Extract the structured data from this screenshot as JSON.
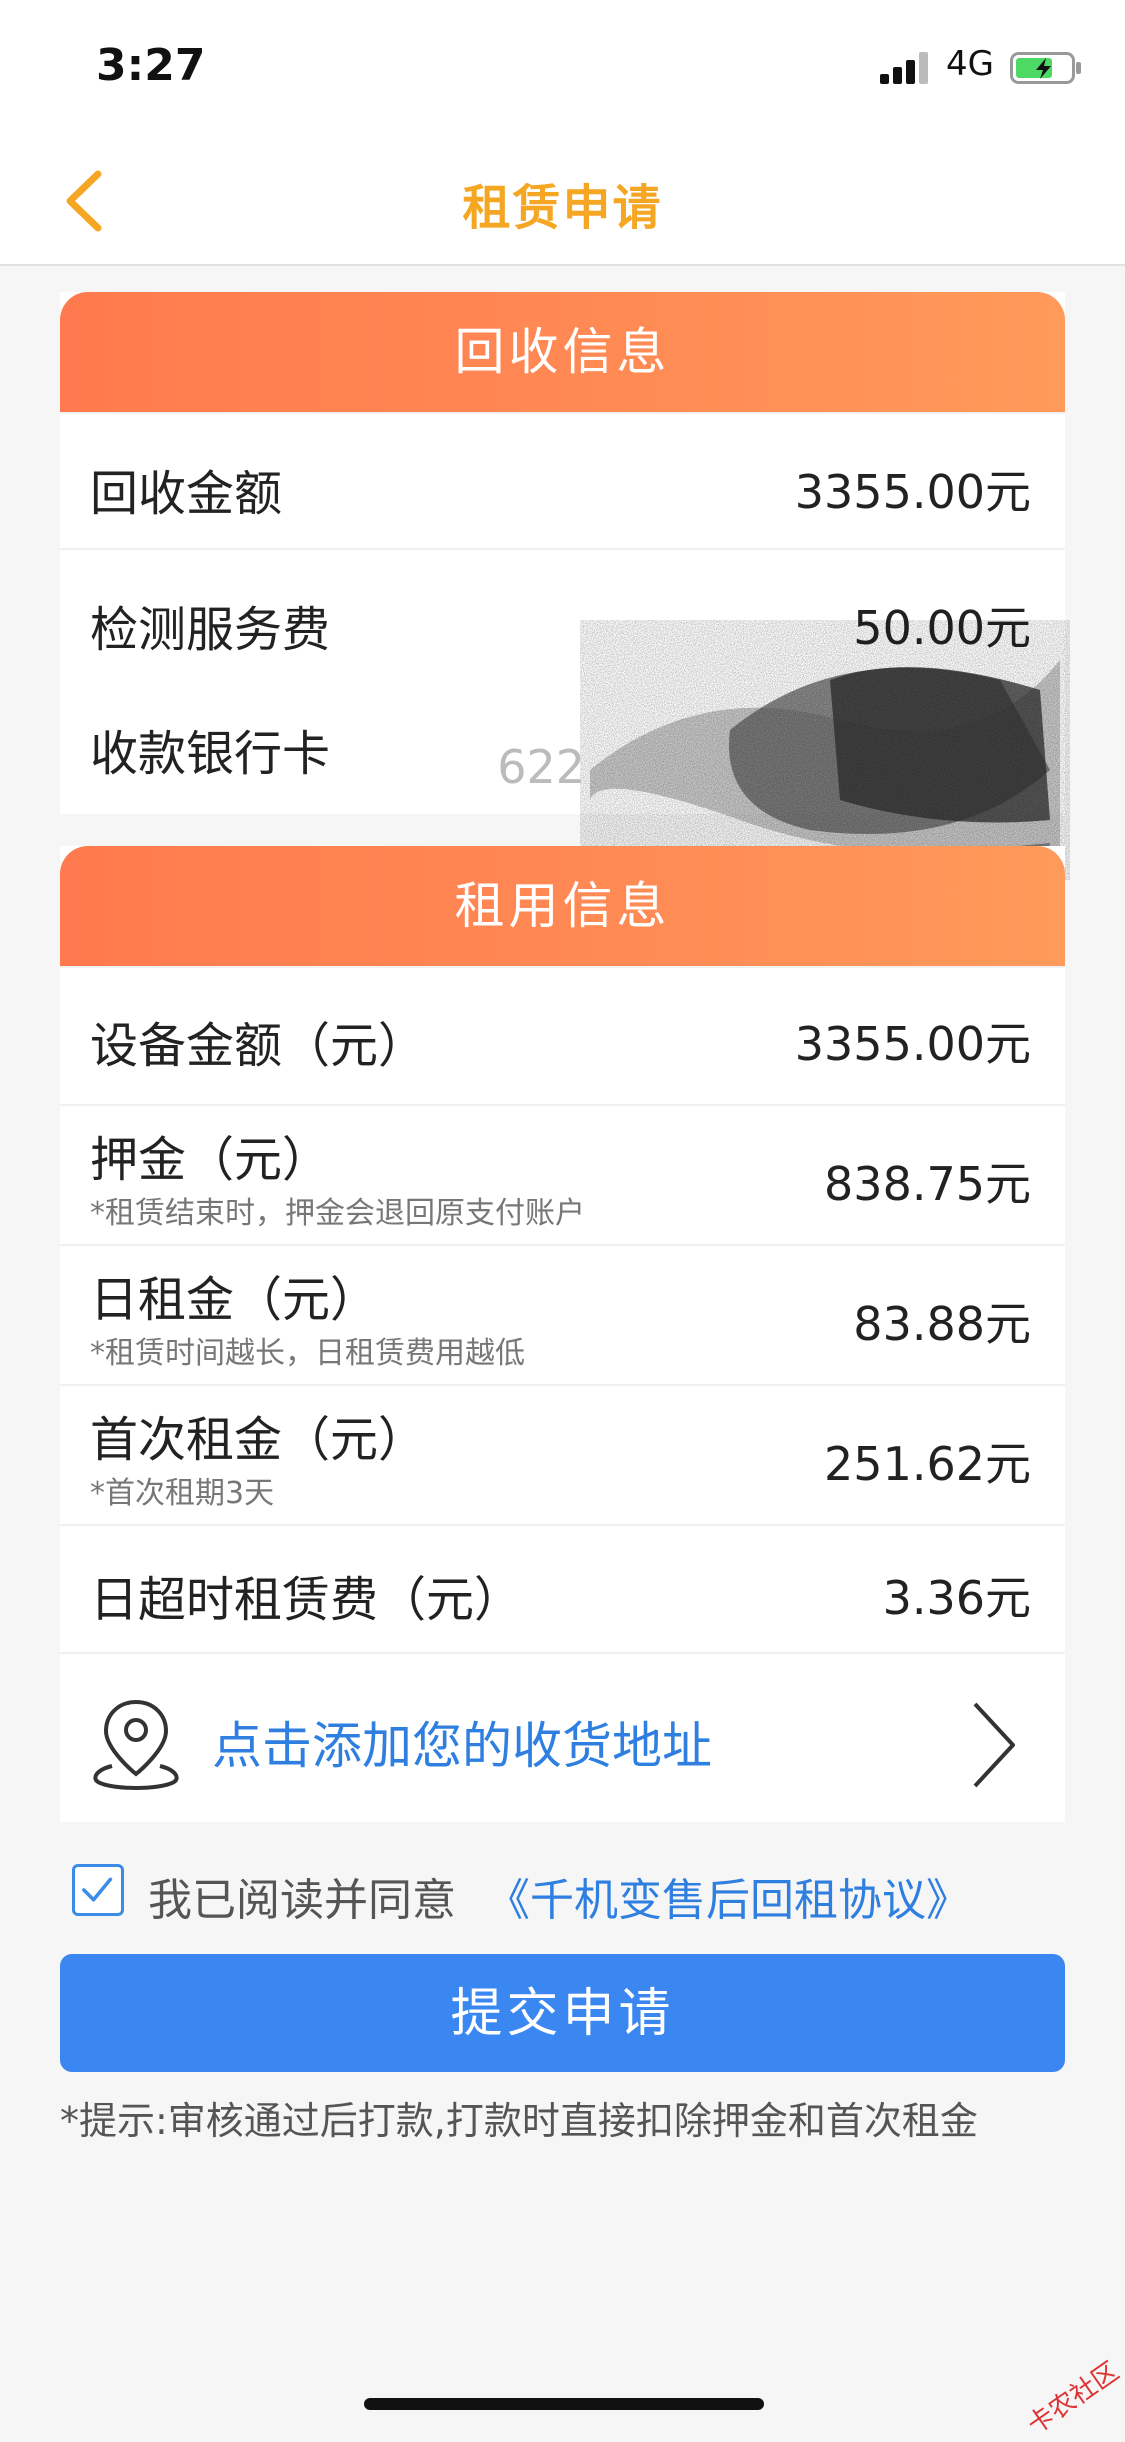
{
  "status_bar": {
    "time": "3:27",
    "network": "4G"
  },
  "nav": {
    "title": "租赁申请"
  },
  "recovery": {
    "header": "回收信息",
    "rows": [
      {
        "label": "回收金额",
        "value": "3355.00元"
      },
      {
        "label": "检测服务费",
        "value": "50.00元"
      },
      {
        "label": "收款银行卡",
        "value": "622"
      }
    ]
  },
  "rental": {
    "header": "租用信息",
    "rows": [
      {
        "label": "设备金额（元）",
        "sub": "",
        "value": "3355.00元"
      },
      {
        "label": "押金（元）",
        "sub": "*租赁结束时，押金会退回原支付账户",
        "value": "838.75元"
      },
      {
        "label": "日租金（元）",
        "sub": "*租赁时间越长，日租赁费用越低",
        "value": "83.88元"
      },
      {
        "label": "首次租金（元）",
        "sub": "*首次租期3天",
        "value": "251.62元"
      },
      {
        "label": "日超时租赁费（元）",
        "sub": "",
        "value": "3.36元"
      }
    ],
    "address_prompt": "点击添加您的收货地址"
  },
  "agreement": {
    "text": "我已阅读并同意",
    "link": "《千机变售后回租协议》",
    "checked": true
  },
  "submit_label": "提交申请",
  "tip": "*提示:审核通过后打款,打款时直接扣除押金和首次租金",
  "watermark": "卡农社区",
  "colors": {
    "accent": "#f5a623",
    "header_orange": "#ff8a54",
    "link_blue": "#2f7fe0",
    "button_blue": "#3b87f2"
  }
}
